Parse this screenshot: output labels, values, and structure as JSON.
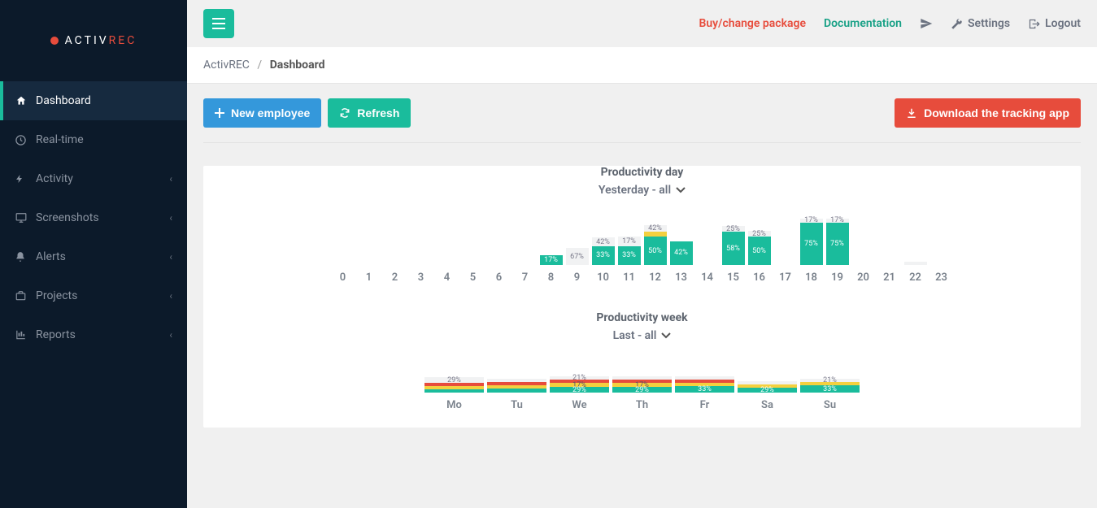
{
  "brand": {
    "prefix": "ACTIV",
    "suffix": "REC"
  },
  "sidebar": {
    "items": [
      {
        "label": "Dashboard",
        "icon": "home",
        "active": true
      },
      {
        "label": "Real-time",
        "icon": "clock",
        "active": false
      },
      {
        "label": "Activity",
        "icon": "bolt",
        "active": false,
        "expandable": true
      },
      {
        "label": "Screenshots",
        "icon": "monitor",
        "active": false,
        "expandable": true
      },
      {
        "label": "Alerts",
        "icon": "bell",
        "active": false,
        "expandable": true
      },
      {
        "label": "Projects",
        "icon": "briefcase",
        "active": false,
        "expandable": true
      },
      {
        "label": "Reports",
        "icon": "bar-chart",
        "active": false,
        "expandable": true
      }
    ]
  },
  "topbar": {
    "buy": "Buy/change package",
    "docs": "Documentation",
    "settings": "Settings",
    "logout": "Logout"
  },
  "breadcrumb": {
    "root": "ActivREC",
    "current": "Dashboard"
  },
  "actions": {
    "new_employee": "New employee",
    "refresh": "Refresh",
    "download": "Download the tracking app"
  },
  "chart_day": {
    "title": "Productivity day",
    "subtitle": "Yesterday - all"
  },
  "chart_week": {
    "title": "Productivity week",
    "subtitle": "Last - all"
  },
  "chart_data": [
    {
      "id": "productivity_day",
      "type": "bar",
      "stacked": true,
      "title": "Productivity day",
      "subtitle": "Yesterday - all",
      "categories": [
        "0",
        "1",
        "2",
        "3",
        "4",
        "5",
        "6",
        "7",
        "8",
        "9",
        "10",
        "11",
        "12",
        "13",
        "14",
        "15",
        "16",
        "17",
        "18",
        "19",
        "20",
        "21",
        "22",
        "23"
      ],
      "unit": "%",
      "ylim": [
        0,
        100
      ],
      "series_order": [
        "teal",
        "warn",
        "red",
        "top"
      ],
      "bars": {
        "0": {
          "total": 0,
          "labels": []
        },
        "1": {
          "total": 0,
          "labels": []
        },
        "2": {
          "total": 0,
          "labels": []
        },
        "3": {
          "total": 0,
          "labels": []
        },
        "4": {
          "total": 0,
          "labels": []
        },
        "5": {
          "total": 0,
          "labels": []
        },
        "6": {
          "total": 0,
          "labels": []
        },
        "7": {
          "total": 0,
          "labels": []
        },
        "8": {
          "total": 17,
          "segments": [
            {
              "color": "teal",
              "value": 17,
              "label": "17%"
            }
          ]
        },
        "9": {
          "total": 30,
          "segments": [
            {
              "color": "top",
              "value": 30,
              "label": "67%"
            }
          ]
        },
        "10": {
          "total": 48,
          "segments": [
            {
              "color": "teal",
              "value": 33,
              "label": "33%"
            },
            {
              "color": "top",
              "value": 15,
              "label": "42%"
            }
          ]
        },
        "11": {
          "total": 50,
          "segments": [
            {
              "color": "teal",
              "value": 33,
              "label": "33%"
            },
            {
              "color": "top",
              "value": 17,
              "label": "17%"
            }
          ]
        },
        "12": {
          "total": 70,
          "segments": [
            {
              "color": "teal",
              "value": 50,
              "label": "50%"
            },
            {
              "color": "warn",
              "value": 8,
              "label": ""
            },
            {
              "color": "top",
              "value": 12,
              "label": "42%"
            }
          ]
        },
        "13": {
          "total": 42,
          "segments": [
            {
              "color": "teal",
              "value": 42,
              "label": "42%"
            }
          ]
        },
        "14": {
          "total": 0,
          "labels": []
        },
        "15": {
          "total": 68,
          "segments": [
            {
              "color": "teal",
              "value": 58,
              "label": "58%"
            },
            {
              "color": "top",
              "value": 10,
              "label": "25%"
            }
          ]
        },
        "16": {
          "total": 60,
          "segments": [
            {
              "color": "teal",
              "value": 50,
              "label": "50%"
            },
            {
              "color": "top",
              "value": 10,
              "label": "25%"
            }
          ]
        },
        "17": {
          "total": 0,
          "labels": []
        },
        "18": {
          "total": 82,
          "segments": [
            {
              "color": "teal",
              "value": 75,
              "label": "75%"
            },
            {
              "color": "top",
              "value": 7,
              "label": "17%"
            }
          ]
        },
        "19": {
          "total": 82,
          "segments": [
            {
              "color": "teal",
              "value": 75,
              "label": "75%"
            },
            {
              "color": "top",
              "value": 7,
              "label": "17%"
            }
          ]
        },
        "20": {
          "total": 0,
          "labels": []
        },
        "21": {
          "total": 0,
          "labels": []
        },
        "22": {
          "total": 6,
          "segments": [
            {
              "color": "top",
              "value": 6,
              "label": ""
            }
          ]
        },
        "23": {
          "total": 0,
          "labels": []
        }
      }
    },
    {
      "id": "productivity_week",
      "type": "bar",
      "stacked": true,
      "title": "Productivity week",
      "subtitle": "Last - all",
      "categories": [
        "Mo",
        "Tu",
        "We",
        "Th",
        "Fr",
        "Sa",
        "Su"
      ],
      "unit": "%",
      "ylim": [
        0,
        100
      ],
      "bars": {
        "Mo": {
          "total": 34,
          "segments": [
            {
              "color": "teal",
              "value": 4,
              "label": ""
            },
            {
              "color": "warn",
              "value": 8,
              "label": ""
            },
            {
              "color": "red",
              "value": 8,
              "label": ""
            },
            {
              "color": "top",
              "value": 14,
              "label": "29%"
            }
          ]
        },
        "Tu": {
          "total": 34,
          "segments": [
            {
              "color": "teal",
              "value": 10,
              "label": ""
            },
            {
              "color": "warn",
              "value": 8,
              "label": ""
            },
            {
              "color": "red",
              "value": 8,
              "label": ""
            },
            {
              "color": "top",
              "value": 8,
              "label": ""
            }
          ]
        },
        "We": {
          "total": 42,
          "segments": [
            {
              "color": "teal",
              "value": 14,
              "label": "29%"
            },
            {
              "color": "warn",
              "value": 10,
              "label": "17%"
            },
            {
              "color": "red",
              "value": 8,
              "label": ""
            },
            {
              "color": "top",
              "value": 10,
              "label": "21%"
            }
          ]
        },
        "Th": {
          "total": 38,
          "segments": [
            {
              "color": "teal",
              "value": 14,
              "label": "29%"
            },
            {
              "color": "warn",
              "value": 10,
              "label": "17%"
            },
            {
              "color": "red",
              "value": 8,
              "label": ""
            },
            {
              "color": "top",
              "value": 6,
              "label": ""
            }
          ]
        },
        "Fr": {
          "total": 32,
          "segments": [
            {
              "color": "teal",
              "value": 16,
              "label": "33%"
            },
            {
              "color": "warn",
              "value": 8,
              "label": ""
            },
            {
              "color": "red",
              "value": 4,
              "label": ""
            },
            {
              "color": "top",
              "value": 4,
              "label": ""
            }
          ]
        },
        "Sa": {
          "total": 22,
          "segments": [
            {
              "color": "teal",
              "value": 12,
              "label": "29%"
            },
            {
              "color": "warn",
              "value": 4,
              "label": ""
            },
            {
              "color": "top",
              "value": 6,
              "label": ""
            }
          ]
        },
        "Su": {
          "total": 32,
          "segments": [
            {
              "color": "teal",
              "value": 18,
              "label": "33%"
            },
            {
              "color": "warn",
              "value": 4,
              "label": ""
            },
            {
              "color": "top",
              "value": 10,
              "label": "21%"
            }
          ]
        }
      }
    }
  ]
}
